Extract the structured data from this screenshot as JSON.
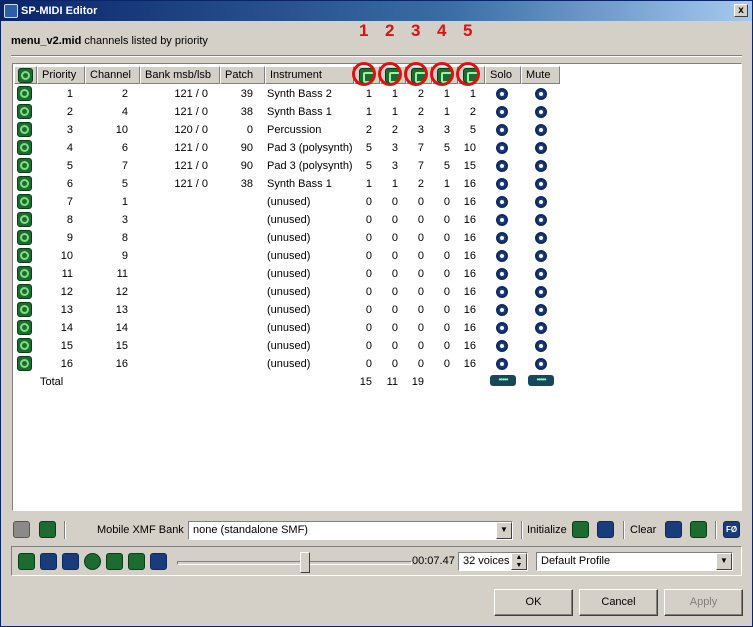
{
  "window": {
    "title": "SP-MIDI Editor",
    "close_glyph": "x"
  },
  "subtitle": {
    "file": "menu_v2.mid",
    "rest": " channels listed by priority"
  },
  "callouts": [
    "1",
    "2",
    "3",
    "4",
    "5"
  ],
  "columns": {
    "priority": "Priority",
    "channel": "Channel",
    "bank": "Bank msb/lsb",
    "patch": "Patch",
    "instrument": "Instrument",
    "solo": "Solo",
    "mute": "Mute"
  },
  "rows": [
    {
      "priority": "1",
      "channel": "2",
      "bank": "121 / 0",
      "patch": "39",
      "instrument": "Synth Bass 2",
      "c1": "1",
      "c2": "1",
      "c3": "2",
      "c4": "1",
      "c5": "1"
    },
    {
      "priority": "2",
      "channel": "4",
      "bank": "121 / 0",
      "patch": "38",
      "instrument": "Synth Bass 1",
      "c1": "1",
      "c2": "1",
      "c3": "2",
      "c4": "1",
      "c5": "2"
    },
    {
      "priority": "3",
      "channel": "10",
      "bank": "120 / 0",
      "patch": "0",
      "instrument": "Percussion",
      "c1": "2",
      "c2": "2",
      "c3": "3",
      "c4": "3",
      "c5": "5"
    },
    {
      "priority": "4",
      "channel": "6",
      "bank": "121 / 0",
      "patch": "90",
      "instrument": "Pad 3 (polysynth)",
      "c1": "5",
      "c2": "3",
      "c3": "7",
      "c4": "5",
      "c5": "10"
    },
    {
      "priority": "5",
      "channel": "7",
      "bank": "121 / 0",
      "patch": "90",
      "instrument": "Pad 3 (polysynth)",
      "c1": "5",
      "c2": "3",
      "c3": "7",
      "c4": "5",
      "c5": "15"
    },
    {
      "priority": "6",
      "channel": "5",
      "bank": "121 / 0",
      "patch": "38",
      "instrument": "Synth Bass 1",
      "c1": "1",
      "c2": "1",
      "c3": "2",
      "c4": "1",
      "c5": "16"
    },
    {
      "priority": "7",
      "channel": "1",
      "bank": "",
      "patch": "",
      "instrument": "(unused)",
      "c1": "0",
      "c2": "0",
      "c3": "0",
      "c4": "0",
      "c5": "16"
    },
    {
      "priority": "8",
      "channel": "3",
      "bank": "",
      "patch": "",
      "instrument": "(unused)",
      "c1": "0",
      "c2": "0",
      "c3": "0",
      "c4": "0",
      "c5": "16"
    },
    {
      "priority": "9",
      "channel": "8",
      "bank": "",
      "patch": "",
      "instrument": "(unused)",
      "c1": "0",
      "c2": "0",
      "c3": "0",
      "c4": "0",
      "c5": "16"
    },
    {
      "priority": "10",
      "channel": "9",
      "bank": "",
      "patch": "",
      "instrument": "(unused)",
      "c1": "0",
      "c2": "0",
      "c3": "0",
      "c4": "0",
      "c5": "16"
    },
    {
      "priority": "11",
      "channel": "11",
      "bank": "",
      "patch": "",
      "instrument": "(unused)",
      "c1": "0",
      "c2": "0",
      "c3": "0",
      "c4": "0",
      "c5": "16"
    },
    {
      "priority": "12",
      "channel": "12",
      "bank": "",
      "patch": "",
      "instrument": "(unused)",
      "c1": "0",
      "c2": "0",
      "c3": "0",
      "c4": "0",
      "c5": "16"
    },
    {
      "priority": "13",
      "channel": "13",
      "bank": "",
      "patch": "",
      "instrument": "(unused)",
      "c1": "0",
      "c2": "0",
      "c3": "0",
      "c4": "0",
      "c5": "16"
    },
    {
      "priority": "14",
      "channel": "14",
      "bank": "",
      "patch": "",
      "instrument": "(unused)",
      "c1": "0",
      "c2": "0",
      "c3": "0",
      "c4": "0",
      "c5": "16"
    },
    {
      "priority": "15",
      "channel": "15",
      "bank": "",
      "patch": "",
      "instrument": "(unused)",
      "c1": "0",
      "c2": "0",
      "c3": "0",
      "c4": "0",
      "c5": "16"
    },
    {
      "priority": "16",
      "channel": "16",
      "bank": "",
      "patch": "",
      "instrument": "(unused)",
      "c1": "0",
      "c2": "0",
      "c3": "0",
      "c4": "0",
      "c5": "16"
    }
  ],
  "total": {
    "label": "Total",
    "c1": "15",
    "c2": "11",
    "c3": "19",
    "solo_btn": "•••••",
    "mute_btn": "•••••"
  },
  "controls": {
    "bank_label": "Mobile XMF Bank",
    "bank_value": "none (standalone SMF)",
    "initialize_label": "Initialize",
    "clear_label": "Clear",
    "f_btn": "FØ"
  },
  "player": {
    "time": "00:07.47",
    "voices": "32 voices",
    "profile": "Default Profile",
    "position": 0.5
  },
  "buttons": {
    "ok": "OK",
    "cancel": "Cancel",
    "apply": "Apply"
  }
}
